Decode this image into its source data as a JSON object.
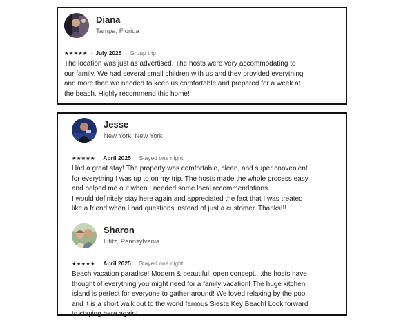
{
  "reviews": [
    {
      "name": "Diana",
      "location": "Tampa, Florida",
      "stars": "★★★★★",
      "date": "July 2025",
      "separator": "·",
      "trip_type": "Group trip",
      "text": "The location was just as advertised. The hosts were very accommodating to\nour family. We had several small children with us and they provided everything\nand more than we needed to keep us comfortable and prepared for a week at\nthe beach. Highly recommend this home!"
    },
    {
      "name": "Jesse",
      "location": "New York, New York",
      "stars": "★★★★★",
      "date": "April 2025",
      "separator": "·",
      "trip_type": "Stayed one night",
      "text": "Had a great stay! The property was comfortable, clean, and super convenient\nfor everything I was up to on my trip. The hosts made the whole process easy\nand helped me out when I needed some local recommendations.\nI would definitely stay here again and appreciated the fact that I was treated\nlike a friend when I had questions instead of just a customer. Thanks!!!"
    },
    {
      "name": "Sharon",
      "location": "Lititz, Pennsylvania",
      "stars": "★★★★★",
      "date": "April 2025",
      "separator": "·",
      "trip_type": "Stayed one night",
      "text": "Beach vacation paradise! Modern & beautiful, open concept....the hosts have\nthought of everything you might need for a family vacation! The huge kitchen\nisland is perfect for everyone to gather around!  We loved relaxing by the pool\nand it is a short walk out to the world famous Siesta Key Beach! Look forward\nto staying here again!"
    }
  ]
}
